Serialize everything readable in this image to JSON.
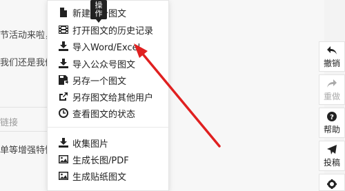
{
  "editor": {
    "lines": [
      "节活动来啦，",
      "我们还是我们",
      "链接",
      "单等增强特性"
    ]
  },
  "tooltip": {
    "text": "操\n作"
  },
  "menu": {
    "items": [
      {
        "label": "新建一个图文",
        "icon": "new-doc-icon"
      },
      {
        "label": "打开图文的历史记录",
        "icon": "film-history-icon"
      },
      {
        "label": "导入Word/Excel",
        "icon": "import-icon"
      },
      {
        "label": "导入公众号图文",
        "icon": "import-icon"
      },
      {
        "label": "另存一个图文",
        "icon": "save-as-icon"
      },
      {
        "label": "另存图文给其他用户",
        "icon": "share-icon"
      },
      {
        "label": "查看图文的状态",
        "icon": "status-clock-icon"
      },
      {
        "label": "收集图片",
        "icon": "collect-icon"
      },
      {
        "label": "生成长图/PDF",
        "icon": "image-icon"
      },
      {
        "label": "生成贴纸图文",
        "icon": "image-icon"
      }
    ]
  },
  "sidebar": {
    "items": [
      {
        "label": "撤销",
        "icon": "undo-icon"
      },
      {
        "label": "重做",
        "icon": "redo-icon"
      },
      {
        "label": "帮助",
        "icon": "help-icon"
      },
      {
        "label": "投稿",
        "icon": "send-icon"
      },
      {
        "label": "",
        "icon": "gear-icon"
      }
    ]
  },
  "colors": {
    "arrow": "#e02020",
    "menu_bg": "#ffffff",
    "tooltip_bg": "#222222"
  }
}
